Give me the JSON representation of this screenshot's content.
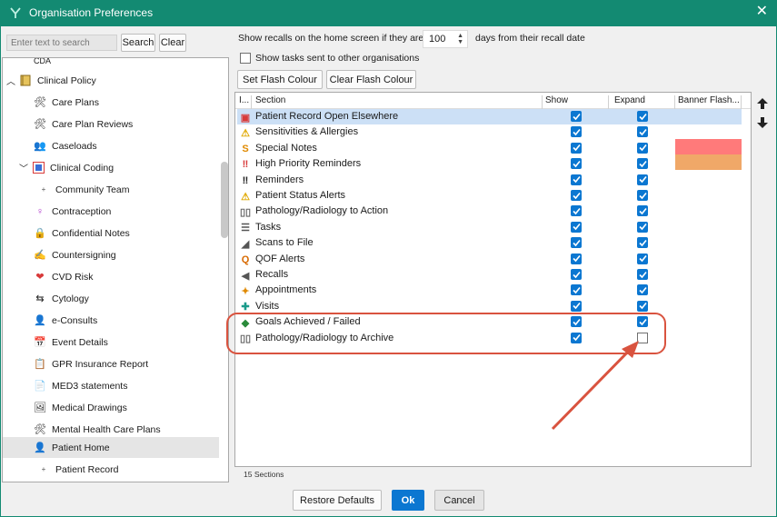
{
  "window": {
    "title": "Organisation Preferences",
    "close_glyph": "✕"
  },
  "search": {
    "placeholder": "Enter text to search",
    "search_label": "Search",
    "clear_label": "Clear"
  },
  "tree": {
    "items": [
      {
        "label": "CDA",
        "icon": "doc-icon"
      },
      {
        "label": "Clinical Policy",
        "icon": "book-icon"
      },
      {
        "label": "Care Plans",
        "icon": "tools-icon"
      },
      {
        "label": "Care Plan Reviews",
        "icon": "tools-icon"
      },
      {
        "label": "Caseloads",
        "icon": "people-icon"
      },
      {
        "label": "Clinical Coding",
        "icon": "coding-icon"
      },
      {
        "label": "Community Team",
        "icon": "dot-icon"
      },
      {
        "label": "Contraception",
        "icon": "female-icon"
      },
      {
        "label": "Confidential Notes",
        "icon": "lock-icon"
      },
      {
        "label": "Countersigning",
        "icon": "sign-icon"
      },
      {
        "label": "CVD Risk",
        "icon": "heart-icon"
      },
      {
        "label": "Cytology",
        "icon": "cytology-icon"
      },
      {
        "label": "e-Consults",
        "icon": "econsult-icon"
      },
      {
        "label": "Event Details",
        "icon": "calendar-icon"
      },
      {
        "label": "GPR Insurance Report",
        "icon": "report-icon"
      },
      {
        "label": "MED3 statements",
        "icon": "statement-icon"
      },
      {
        "label": "Medical Drawings",
        "icon": "drawing-icon"
      },
      {
        "label": "Mental Health Care Plans",
        "icon": "tools-icon"
      },
      {
        "label": "Patient Home",
        "icon": "patient-home-icon"
      },
      {
        "label": "Patient Record",
        "icon": "dot-icon"
      }
    ]
  },
  "recall": {
    "prefix": "Show recalls on the home screen if they are",
    "value": "100",
    "suffix": "days from their recall date"
  },
  "tasks_checkbox": {
    "label": "Show tasks sent to other organisations"
  },
  "flash": {
    "set_label": "Set Flash Colour",
    "clear_label": "Clear Flash Colour"
  },
  "grid": {
    "headers": {
      "i": "I...",
      "section": "Section",
      "show": "Show",
      "expand": "Expand",
      "banner": "Banner Flash..."
    },
    "rows": [
      {
        "name": "Patient Record Open Elsewhere",
        "icon": "alert-record-icon",
        "show": true,
        "expand": true
      },
      {
        "name": "Sensitivities & Allergies",
        "icon": "allergy-icon",
        "show": true,
        "expand": true
      },
      {
        "name": "Special Notes",
        "icon": "special-notes-icon",
        "show": true,
        "expand": true
      },
      {
        "name": "High Priority Reminders",
        "icon": "double-exclaim-red-icon",
        "show": true,
        "expand": true
      },
      {
        "name": "Reminders",
        "icon": "double-exclaim-icon",
        "show": true,
        "expand": true
      },
      {
        "name": "Patient Status Alerts",
        "icon": "warning-icon",
        "show": true,
        "expand": true
      },
      {
        "name": "Pathology/Radiology to Action",
        "icon": "test-tubes-icon",
        "show": true,
        "expand": true
      },
      {
        "name": "Tasks",
        "icon": "tasks-icon",
        "show": true,
        "expand": true
      },
      {
        "name": "Scans to File",
        "icon": "scan-icon",
        "show": true,
        "expand": true
      },
      {
        "name": "QOF Alerts",
        "icon": "qof-icon",
        "show": true,
        "expand": true
      },
      {
        "name": "Recalls",
        "icon": "recall-icon",
        "show": true,
        "expand": true
      },
      {
        "name": "Appointments",
        "icon": "appointment-icon",
        "show": true,
        "expand": true
      },
      {
        "name": "Visits",
        "icon": "visits-icon",
        "show": true,
        "expand": true
      },
      {
        "name": "Goals Achieved / Failed",
        "icon": "goals-icon",
        "show": true,
        "expand": true
      },
      {
        "name": "Pathology/Radiology to Archive",
        "icon": "test-tubes-icon",
        "show": true,
        "expand": false
      }
    ],
    "flash_colours": [
      "#ff7a7a",
      "#f0a868"
    ]
  },
  "footer": {
    "count": "15 Sections"
  },
  "buttons": {
    "restore": "Restore Defaults",
    "ok": "Ok",
    "cancel": "Cancel"
  },
  "colors": {
    "titlebar": "#138a72",
    "check": "#0b77d1",
    "annotation": "#d9533f",
    "ok_button": "#0b77d1"
  }
}
